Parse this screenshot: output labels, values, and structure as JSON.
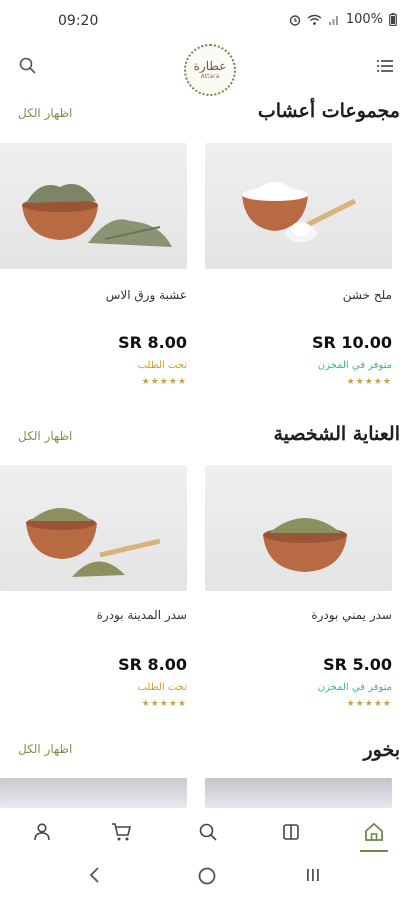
{
  "status": {
    "time": "09:20",
    "battery": "100%"
  },
  "header": {
    "logo_text": "عطارة",
    "logo_sub": "Attara"
  },
  "sections": [
    {
      "title": "مجموعات أعشاب",
      "show_all": "اظهار الكل",
      "products": [
        {
          "name": "ملح خشن",
          "price": "SR 10.00",
          "stock": "متوفر في المخزن",
          "stars": "★★★★★"
        },
        {
          "name": "عشبة ورق الاس",
          "price": "SR 8.00",
          "stock": "تحت الطلب",
          "stars": "★★★★★"
        }
      ]
    },
    {
      "title": "العناية الشخصية",
      "show_all": "اظهار الكل",
      "products": [
        {
          "name": "سدر يمني بودرة",
          "price": "SR 5.00",
          "stock": "متوفر في المخزن",
          "stars": "★★★★★"
        },
        {
          "name": "سدر المدينة بودرة",
          "price": "SR 8.00",
          "stock": "تحت الطلب",
          "stars": "★★★★★"
        }
      ]
    },
    {
      "title": "بخور",
      "show_all": "اظهار الكل"
    }
  ],
  "colors": {
    "accent": "#6f8a4a",
    "in_stock": "#3ab796",
    "on_order": "#d6a019"
  },
  "tabs": [
    "home-icon",
    "book-icon",
    "search-icon",
    "cart-icon",
    "user-icon"
  ]
}
